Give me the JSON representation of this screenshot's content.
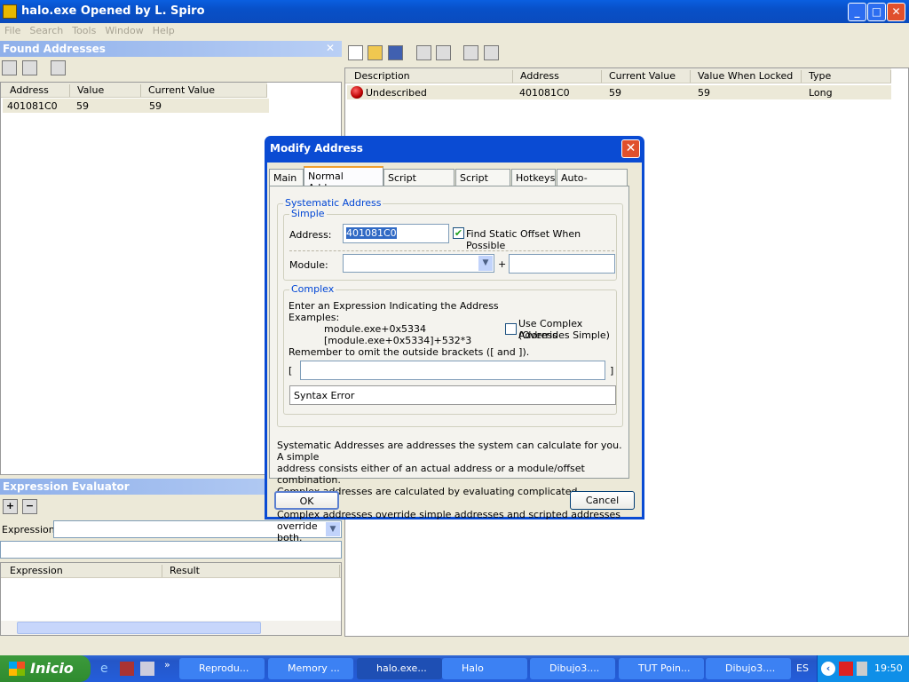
{
  "window": {
    "title": "halo.exe Opened by L. Spiro",
    "minimize": "_",
    "maximize": "□",
    "close": "✕"
  },
  "menu": [
    "File",
    "Search",
    "Tools",
    "Window",
    "Help"
  ],
  "found": {
    "title": "Found Addresses",
    "close": "✕",
    "columns": [
      "Address",
      "Value",
      "Current Value"
    ],
    "rows": [
      [
        "401081C0",
        "59",
        "59"
      ]
    ]
  },
  "locked": {
    "columns": [
      "Description",
      "Address",
      "Current Value",
      "Value When Locked",
      "Type"
    ],
    "rows": [
      [
        "Undescribed",
        "401081C0",
        "59",
        "59",
        "Long"
      ]
    ]
  },
  "evaluator": {
    "title": "Expression Evaluator",
    "expression_label": "Expression:",
    "columns": [
      "Expression",
      "Result"
    ]
  },
  "dialog": {
    "title": "Modify Address",
    "tabs": [
      "Main",
      "Normal Address",
      "Script Address",
      "Script Lock",
      "Hotkeys",
      "Auto-Assemble"
    ],
    "active_tab": "Normal Address",
    "systematic_label": "Systematic Address",
    "simple_label": "Simple",
    "address_label": "Address:",
    "address_value": "401081C0",
    "find_static": "Find Static Offset When Possible",
    "find_static_checked": true,
    "module_label": "Module:",
    "plus": "+",
    "complex_label": "Complex",
    "complex_text": [
      "Enter an Expression Indicating the Address",
      "Examples:",
      "module.exe+0x5334",
      "[module.exe+0x5334]+532*3",
      "Remember to omit the outside brackets ([ and ])."
    ],
    "use_complex": "Use Complex Address",
    "overrides": "(Overrides Simple)",
    "use_complex_checked": false,
    "lbracket": "[",
    "rbracket": "]",
    "syntax": "Syntax Error",
    "description": [
      "Systematic Addresses are addresses the system can calculate for you.  A simple",
      "address consists either of an actual address or a module/offset combination.",
      "Complex addresses are calculated by evaluating complicated expressions.",
      "Complex addresses override simple addresses and scripted addresses override",
      "both."
    ],
    "ok": "OK",
    "cancel": "Cancel"
  },
  "taskbar": {
    "start": "Inicio",
    "tasks": [
      "Reprodu...",
      "Memory ...",
      "halo.exe...",
      "Halo",
      "Dibujo3....",
      "TUT Poin...",
      "Dibujo3...."
    ],
    "active": "halo.exe...",
    "lang": "ES",
    "clock": "19:50"
  }
}
